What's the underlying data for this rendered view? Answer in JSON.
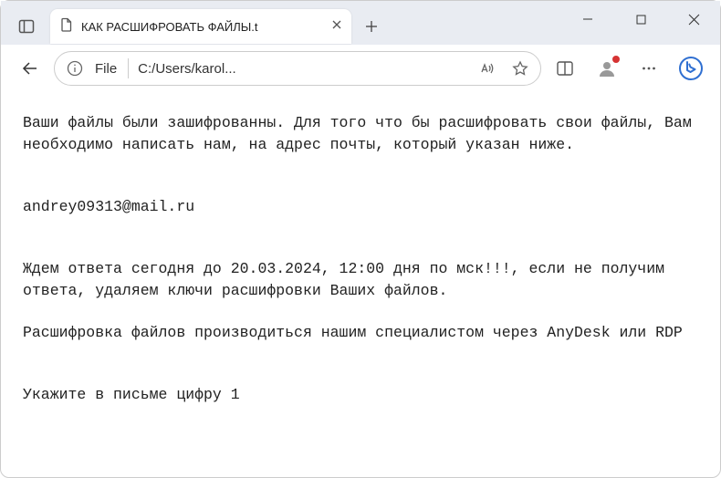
{
  "titlebar": {
    "tab_title": "КАК РАСШИФРОВАТЬ ФАЙЛЫ.t"
  },
  "addressbar": {
    "protocol": "File",
    "path": "C:/Users/karol..."
  },
  "content": {
    "p1": "Ваши файлы были зашифрованны. Для того что бы расшифровать свои файлы, Вам необходимо написать нам, на адрес почты, который указан ниже.",
    "email": "andrey09313@mail.ru",
    "p2": "Ждем ответа сегодня до 20.03.2024, 12:00 дня по мск!!!, если не получим ответа, удаляем ключи расшифровки Ваших файлов.",
    "p3": "Расшифровка файлов производиться нашим специалистом через AnyDesk или RDP",
    "p4": "Укажите в письме цифру 1"
  }
}
